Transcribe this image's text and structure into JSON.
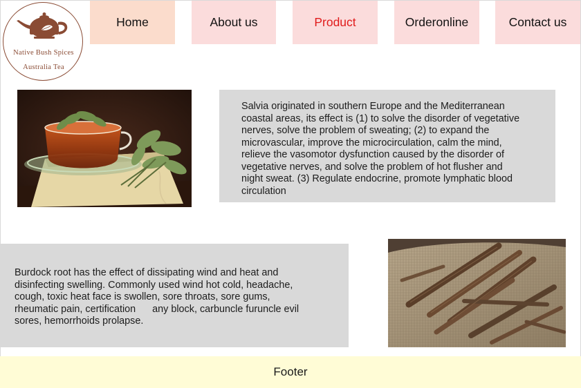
{
  "brand": {
    "logo_line1": "Native Bush Spices",
    "logo_line2": "Australia Tea",
    "logo_color": "#8a4b34",
    "icon": "teapot-icon"
  },
  "nav": {
    "items": [
      {
        "label": "Home",
        "bg": "#fbdccc"
      },
      {
        "label": "About us",
        "bg": "#fbdcdc"
      },
      {
        "label": "Product",
        "bg": "#fbdcdc"
      },
      {
        "label": "Orderonline",
        "bg": "#fbdcdc"
      },
      {
        "label": "Contact us",
        "bg": "#fbdcdc"
      }
    ],
    "active": "Product",
    "active_color": "#e01b1b"
  },
  "products": [
    {
      "name": "sage-tea",
      "image": "sage-tea-photo",
      "text_lines": [
        "Salvia originated in southern Europe and the Mediterranean",
        "coastal areas, its effect is (1) to solve the disorder of vegetative",
        "nerves, solve the problem of sweating; (2) to expand the",
        "microvascular, improve the microcirculation, calm the mind,",
        "relieve the vasomotor dysfunction caused by the disorder of",
        "vegetative nerves, and solve the problem of hot flusher and",
        "night sweat. (3) Regulate endocrine, promote lymphatic blood",
        "circulation"
      ]
    },
    {
      "name": "burdock-root",
      "image": "burdock-root-photo",
      "text_lines": [
        "Burdock root has the effect of dissipating wind and heat and",
        "disinfecting swelling. Commonly used wind hot cold, headache,",
        "cough, toxic heat face is swollen, sore throats, sore gums,",
        "rheumatic pain, certification      any block, carbuncle furuncle evil",
        "sores, hemorrhoids prolapse."
      ]
    }
  ],
  "footer": {
    "label": "Footer",
    "bg": "#fffcd6"
  },
  "colors": {
    "text_box_bg": "#d9d9d9"
  }
}
